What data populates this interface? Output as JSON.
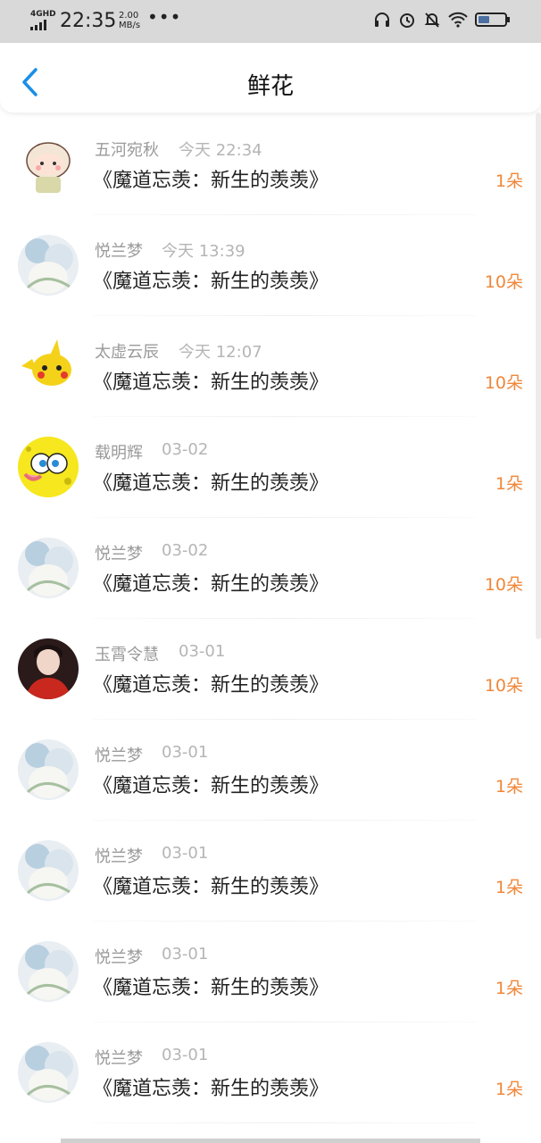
{
  "status": {
    "network": "4GHD",
    "time": "22:35",
    "speed_value": "2.00",
    "speed_unit": "MB/s",
    "dots": "•••"
  },
  "header": {
    "title": "鲜花"
  },
  "colors": {
    "accent": "#1a8fe6",
    "count": "#f0873a"
  },
  "items": [
    {
      "name": "五河宛秋",
      "time": "今天 22:34",
      "work": "《魔道忘羡：新生的羡羡》",
      "count": "1朵",
      "avatar": "cartoon-bear"
    },
    {
      "name": "悦兰梦",
      "time": "今天 13:39",
      "work": "《魔道忘羡：新生的羡羡》",
      "count": "10朵",
      "avatar": "art-portrait"
    },
    {
      "name": "太虚云辰",
      "time": "今天 12:07",
      "work": "《魔道忘羡：新生的羡羡》",
      "count": "10朵",
      "avatar": "pikachu"
    },
    {
      "name": "载明辉",
      "time": "03-02",
      "work": "《魔道忘羡：新生的羡羡》",
      "count": "1朵",
      "avatar": "spongebob"
    },
    {
      "name": "悦兰梦",
      "time": "03-02",
      "work": "《魔道忘羡：新生的羡羡》",
      "count": "10朵",
      "avatar": "art-portrait"
    },
    {
      "name": "玉霄令慧",
      "time": "03-01",
      "work": "《魔道忘羡：新生的羡羡》",
      "count": "10朵",
      "avatar": "person-red"
    },
    {
      "name": "悦兰梦",
      "time": "03-01",
      "work": "《魔道忘羡：新生的羡羡》",
      "count": "1朵",
      "avatar": "art-portrait"
    },
    {
      "name": "悦兰梦",
      "time": "03-01",
      "work": "《魔道忘羡：新生的羡羡》",
      "count": "1朵",
      "avatar": "art-portrait"
    },
    {
      "name": "悦兰梦",
      "time": "03-01",
      "work": "《魔道忘羡：新生的羡羡》",
      "count": "1朵",
      "avatar": "art-portrait"
    },
    {
      "name": "悦兰梦",
      "time": "03-01",
      "work": "《魔道忘羡：新生的羡羡》",
      "count": "1朵",
      "avatar": "art-portrait"
    }
  ]
}
